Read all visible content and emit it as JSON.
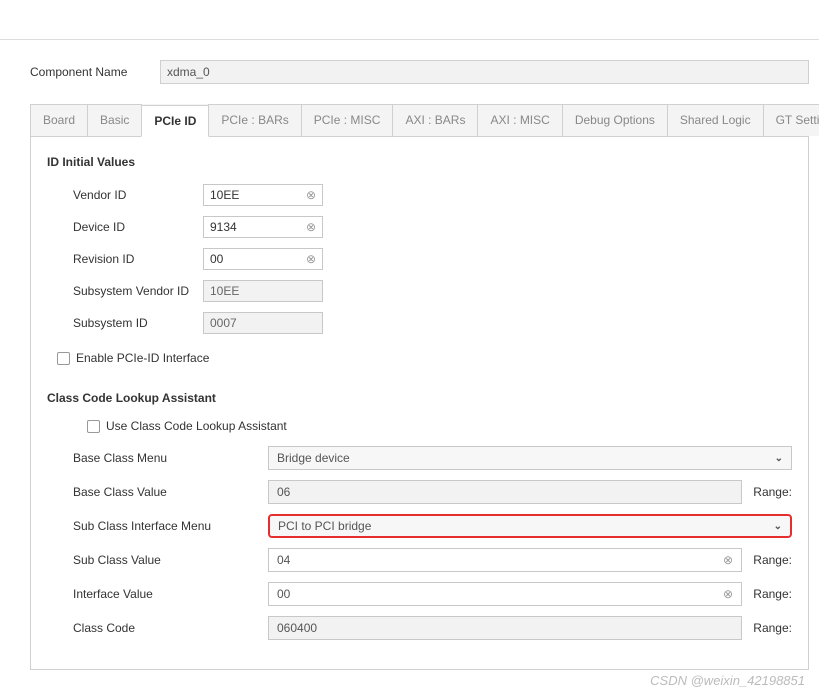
{
  "componentName": {
    "label": "Component Name",
    "value": "xdma_0"
  },
  "tabs": [
    "Board",
    "Basic",
    "PCIe ID",
    "PCIe : BARs",
    "PCIe : MISC",
    "AXI : BARs",
    "AXI : MISC",
    "Debug Options",
    "Shared Logic",
    "GT Settings"
  ],
  "activeTabIndex": 2,
  "idInitial": {
    "heading": "ID Initial Values",
    "fields": [
      {
        "label": "Vendor ID",
        "value": "10EE",
        "clearable": true,
        "readonly": false
      },
      {
        "label": "Device ID",
        "value": "9134",
        "clearable": true,
        "readonly": false
      },
      {
        "label": "Revision ID",
        "value": "00",
        "clearable": true,
        "readonly": false
      },
      {
        "label": "Subsystem Vendor ID",
        "value": "10EE",
        "clearable": false,
        "readonly": true
      },
      {
        "label": "Subsystem ID",
        "value": "0007",
        "clearable": false,
        "readonly": true
      }
    ],
    "enableInterface": {
      "label": "Enable PCIe-ID Interface",
      "checked": false
    }
  },
  "classCode": {
    "heading": "Class Code Lookup Assistant",
    "useAssistant": {
      "label": "Use Class Code Lookup Assistant",
      "checked": false
    },
    "rows": [
      {
        "kind": "drop",
        "label": "Base Class Menu",
        "value": "Bridge device",
        "highlight": false
      },
      {
        "kind": "text",
        "label": "Base Class Value",
        "value": "06",
        "range": "Range:",
        "clearable": false,
        "readonly": true
      },
      {
        "kind": "drop",
        "label": "Sub Class Interface Menu",
        "value": "PCI to PCI bridge",
        "highlight": true
      },
      {
        "kind": "text",
        "label": "Sub Class Value",
        "value": "04",
        "range": "Range:",
        "clearable": true,
        "readonly": false
      },
      {
        "kind": "text",
        "label": "Interface Value",
        "value": "00",
        "range": "Range:",
        "clearable": true,
        "readonly": false
      },
      {
        "kind": "text",
        "label": "Class Code",
        "value": "060400",
        "range": "Range:",
        "clearable": false,
        "readonly": true
      }
    ]
  },
  "watermark": "CSDN @weixin_42198851"
}
